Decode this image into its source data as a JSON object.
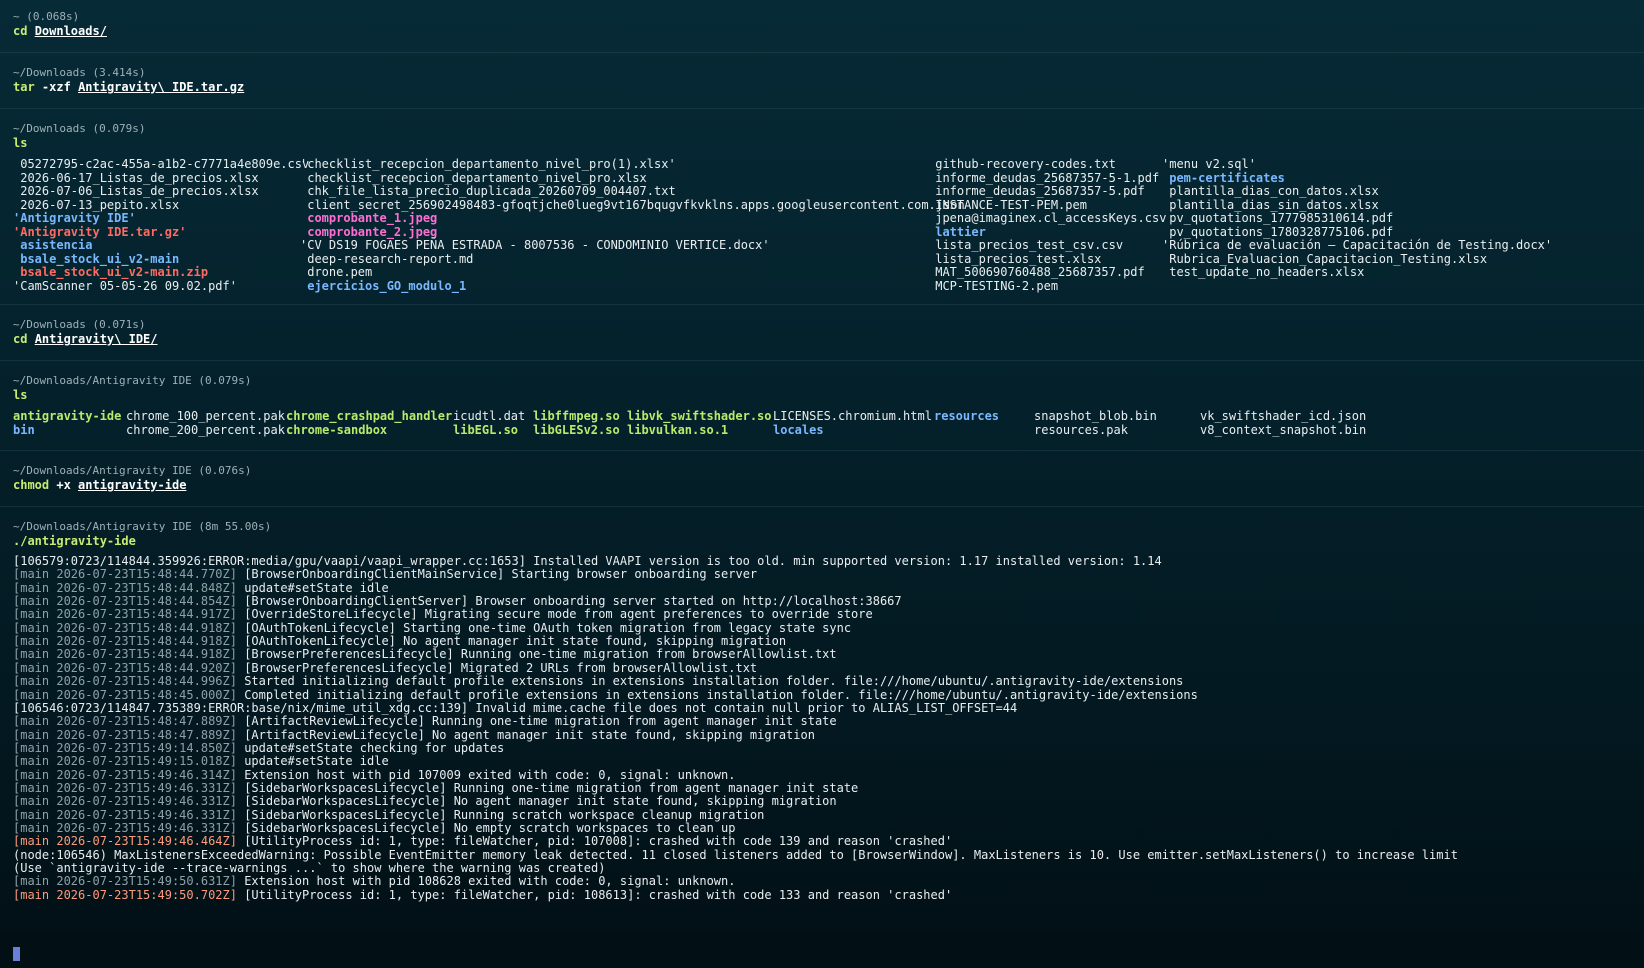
{
  "blocks": [
    {
      "context": "~ (0.068s)",
      "cmd": "cd",
      "args": "Downloads/"
    },
    {
      "context": "~/Downloads (3.414s)",
      "cmd": "tar",
      "flags": "-xzf",
      "args": "Antigravity\\ IDE.tar.gz"
    },
    {
      "context": "~/Downloads (0.079s)",
      "cmd": "ls"
    },
    {
      "context": "~/Downloads (0.071s)",
      "cmd": "cd",
      "args": "Antigravity\\ IDE/"
    },
    {
      "context": "~/Downloads/Antigravity IDE (0.079s)",
      "cmd": "ls"
    },
    {
      "context": "~/Downloads/Antigravity IDE (0.076s)",
      "cmd": "chmod",
      "flags": "+x",
      "args": "antigravity-ide"
    },
    {
      "context": "~/Downloads/Antigravity IDE (8m 55.00s)",
      "cmd": "./antigravity-ide"
    }
  ],
  "ls1": {
    "col1": [
      {
        "t": " 05272795-c2ac-455a-a1b2-c7771a4e809e.csv",
        "k": "file"
      },
      {
        "t": " 2026-06-17_Listas_de_precios.xlsx",
        "k": "file"
      },
      {
        "t": " 2026-07-06_Listas_de_precios.xlsx",
        "k": "file"
      },
      {
        "t": " 2026-07-13_pepito.xlsx",
        "k": "file"
      },
      {
        "t": "'Antigravity IDE'",
        "k": "dir"
      },
      {
        "t": "'Antigravity IDE.tar.gz'",
        "k": "arc"
      },
      {
        "t": " asistencia",
        "k": "dir"
      },
      {
        "t": " bsale_stock_ui_v2-main",
        "k": "dir"
      },
      {
        "t": " bsale_stock_ui_v2-main.zip",
        "k": "arc"
      },
      {
        "t": "'CamScanner 05-05-26 09.02.pdf'",
        "k": "file"
      }
    ],
    "col2": [
      {
        "t": "'checklist_recepcion_departamento_nivel_pro(1).xlsx'",
        "k": "file"
      },
      {
        "t": " checklist_recepcion_departamento_nivel_pro.xlsx",
        "k": "file"
      },
      {
        "t": " chk_file_lista_precio_duplicada_20260709_004407.txt",
        "k": "file"
      },
      {
        "t": " client_secret_256902498483-gfoqtjche0lueg9vt167bqugvfkvklns.apps.googleusercontent.com.json",
        "k": "file"
      },
      {
        "t": " comprobante_1.jpeg",
        "k": "img"
      },
      {
        "t": " comprobante_2.jpeg",
        "k": "img"
      },
      {
        "t": "'CV DS19 FOGAES PEÑA ESTRADA - 8007536 - CONDOMINIO VERTICE.docx'",
        "k": "file"
      },
      {
        "t": " deep-research-report.md",
        "k": "file"
      },
      {
        "t": " drone.pem",
        "k": "file"
      },
      {
        "t": " ejercicios_GO_modulo_1",
        "k": "dir"
      }
    ],
    "col3": [
      {
        "t": " github-recovery-codes.txt",
        "k": "file"
      },
      {
        "t": " informe_deudas_25687357-5-1.pdf",
        "k": "file"
      },
      {
        "t": " informe_deudas_25687357-5.pdf",
        "k": "file"
      },
      {
        "t": " INSTANCE-TEST-PEM.pem",
        "k": "file"
      },
      {
        "t": " jpena@imaginex.cl_accessKeys.csv",
        "k": "file"
      },
      {
        "t": " lattier",
        "k": "dir"
      },
      {
        "t": " lista_precios_test_csv.csv",
        "k": "file"
      },
      {
        "t": " lista_precios_test.xlsx",
        "k": "file"
      },
      {
        "t": " MAT_500690760488_25687357.pdf",
        "k": "file"
      },
      {
        "t": " MCP-TESTING-2.pem",
        "k": "file"
      }
    ],
    "col4": [
      {
        "t": "'menu v2.sql'",
        "k": "file"
      },
      {
        "t": " pem-certificates",
        "k": "dir"
      },
      {
        "t": " plantilla_dias_con_datos.xlsx",
        "k": "file"
      },
      {
        "t": " plantilla_dias_sin_datos.xlsx",
        "k": "file"
      },
      {
        "t": " pv_quotations_1777985310614.pdf",
        "k": "file"
      },
      {
        "t": " pv_quotations_1780328775106.pdf",
        "k": "file"
      },
      {
        "t": "'Rúbrica de evaluación – Capacitación de Testing.docx'",
        "k": "file"
      },
      {
        "t": " Rubrica_Evaluacion_Capacitacion_Testing.xlsx",
        "k": "file"
      },
      {
        "t": " test_update_no_headers.xlsx",
        "k": "file"
      }
    ]
  },
  "ls2": {
    "row1": [
      {
        "t": "antigravity-ide",
        "k": "exe"
      },
      {
        "t": "chrome_100_percent.pak",
        "k": "file"
      },
      {
        "t": "chrome_crashpad_handler",
        "k": "exe"
      },
      {
        "t": "icudtl.dat",
        "k": "file"
      },
      {
        "t": "libffmpeg.so",
        "k": "exe"
      },
      {
        "t": "libvk_swiftshader.so",
        "k": "exe"
      },
      {
        "t": "LICENSES.chromium.html",
        "k": "file"
      },
      {
        "t": "resources",
        "k": "dir"
      },
      {
        "t": "snapshot_blob.bin",
        "k": "file"
      },
      {
        "t": "vk_swiftshader_icd.json",
        "k": "file"
      }
    ],
    "row2": [
      {
        "t": "bin",
        "k": "dir"
      },
      {
        "t": "chrome_200_percent.pak",
        "k": "file"
      },
      {
        "t": "chrome-sandbox",
        "k": "exe"
      },
      {
        "t": "libEGL.so",
        "k": "exe"
      },
      {
        "t": "libGLESv2.so",
        "k": "exe"
      },
      {
        "t": "libvulkan.so.1",
        "k": "exe"
      },
      {
        "t": "locales",
        "k": "dir"
      },
      {
        "t": "",
        "k": "file"
      },
      {
        "t": "resources.pak",
        "k": "file"
      },
      {
        "t": "v8_context_snapshot.bin",
        "k": "file"
      }
    ]
  },
  "output": [
    {
      "ts": "",
      "msg": "[106579:0723/114844.359926:ERROR:media/gpu/vaapi/vaapi_wrapper.cc:1653] Installed VAAPI version is too old. min supported version: 1.17 installed version: 1.14"
    },
    {
      "ts": "[main 2026-07-23T15:48:44.770Z]",
      "msg": " [BrowserOnboardingClientMainService] Starting browser onboarding server"
    },
    {
      "ts": "[main 2026-07-23T15:48:44.848Z]",
      "msg": " update#setState idle"
    },
    {
      "ts": "[main 2026-07-23T15:48:44.854Z]",
      "msg": " [BrowserOnboardingClientServer] Browser onboarding server started on http://localhost:38667"
    },
    {
      "ts": "[main 2026-07-23T15:48:44.917Z]",
      "msg": " [OverrideStoreLifecycle] Migrating secure mode from agent preferences to override store"
    },
    {
      "ts": "[main 2026-07-23T15:48:44.918Z]",
      "msg": " [OAuthTokenLifecycle] Starting one-time OAuth token migration from legacy state sync"
    },
    {
      "ts": "[main 2026-07-23T15:48:44.918Z]",
      "msg": " [OAuthTokenLifecycle] No agent manager init state found, skipping migration"
    },
    {
      "ts": "[main 2026-07-23T15:48:44.918Z]",
      "msg": " [BrowserPreferencesLifecycle] Running one-time migration from browserAllowlist.txt"
    },
    {
      "ts": "[main 2026-07-23T15:48:44.920Z]",
      "msg": " [BrowserPreferencesLifecycle] Migrated 2 URLs from browserAllowlist.txt"
    },
    {
      "ts": "[main 2026-07-23T15:48:44.996Z]",
      "msg": " Started initializing default profile extensions in extensions installation folder. file:///home/ubuntu/.antigravity-ide/extensions"
    },
    {
      "ts": "[main 2026-07-23T15:48:45.000Z]",
      "msg": " Completed initializing default profile extensions in extensions installation folder. file:///home/ubuntu/.antigravity-ide/extensions"
    },
    {
      "ts": "",
      "msg": "[106546:0723/114847.735389:ERROR:base/nix/mime_util_xdg.cc:139] Invalid mime.cache file does not contain null prior to ALIAS_LIST_OFFSET=44"
    },
    {
      "ts": "[main 2026-07-23T15:48:47.889Z]",
      "msg": " [ArtifactReviewLifecycle] Running one-time migration from agent manager init state"
    },
    {
      "ts": "[main 2026-07-23T15:48:47.889Z]",
      "msg": " [ArtifactReviewLifecycle] No agent manager init state found, skipping migration"
    },
    {
      "ts": "[main 2026-07-23T15:49:14.850Z]",
      "msg": " update#setState checking for updates"
    },
    {
      "ts": "[main 2026-07-23T15:49:15.018Z]",
      "msg": " update#setState idle"
    },
    {
      "ts": "[main 2026-07-23T15:49:46.314Z]",
      "msg": " Extension host with pid 107009 exited with code: 0, signal: unknown."
    },
    {
      "ts": "[main 2026-07-23T15:49:46.331Z]",
      "msg": " [SidebarWorkspacesLifecycle] Running one-time migration from agent manager init state"
    },
    {
      "ts": "[main 2026-07-23T15:49:46.331Z]",
      "msg": " [SidebarWorkspacesLifecycle] No agent manager init state found, skipping migration"
    },
    {
      "ts": "[main 2026-07-23T15:49:46.331Z]",
      "msg": " [SidebarWorkspacesLifecycle] Running scratch workspace cleanup migration"
    },
    {
      "ts": "[main 2026-07-23T15:49:46.331Z]",
      "msg": " [SidebarWorkspacesLifecycle] No empty scratch workspaces to clean up"
    },
    {
      "ts": "[main 2026-07-23T15:49:46.464Z]",
      "msg": " [UtilityProcess id: 1, type: fileWatcher, pid: 107008]: crashed with code 139 and reason 'crashed'",
      "err": true
    },
    {
      "ts": "",
      "msg": "(node:106546) MaxListenersExceededWarning: Possible EventEmitter memory leak detected. 11 closed listeners added to [BrowserWindow]. MaxListeners is 10. Use emitter.setMaxListeners() to increase limit"
    },
    {
      "ts": "",
      "msg": "(Use `antigravity-ide --trace-warnings ...` to show where the warning was created)"
    },
    {
      "ts": "[main 2026-07-23T15:49:50.631Z]",
      "msg": " Extension host with pid 108628 exited with code: 0, signal: unknown."
    },
    {
      "ts": "[main 2026-07-23T15:49:50.702Z]",
      "msg": " [UtilityProcess id: 1, type: fileWatcher, pid: 108613]: crashed with code 133 and reason 'crashed'",
      "err": true
    }
  ],
  "colors": {
    "background": "#04212b",
    "command": "#c8ec6f",
    "directory": "#79b8ff",
    "archive": "#ff6b62",
    "image": "#ff6fd3",
    "executable": "#b7ec6a"
  },
  "icons": {
    "cursor": "block-cursor"
  }
}
